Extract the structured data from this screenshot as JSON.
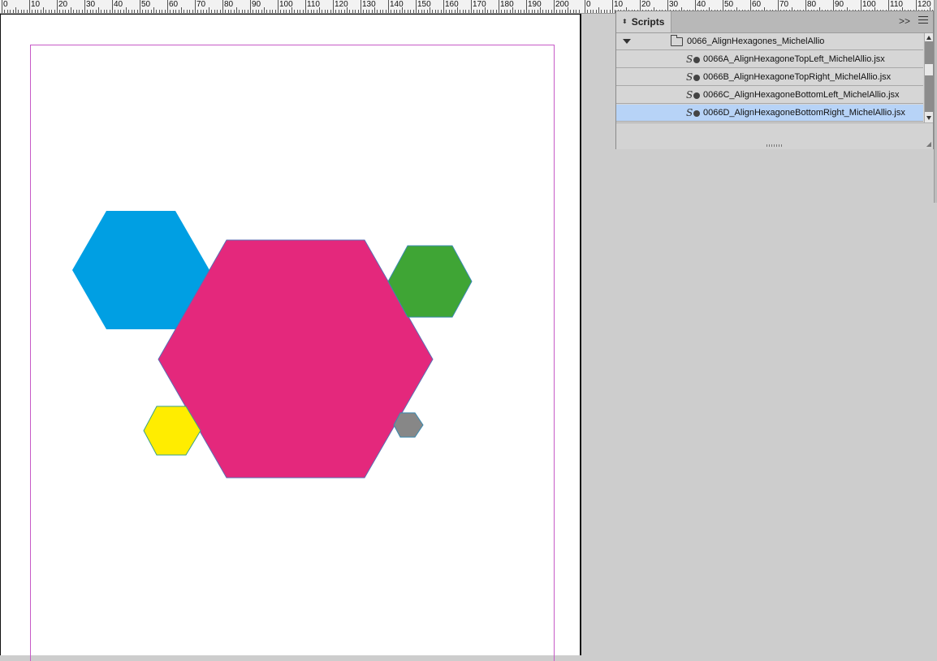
{
  "ruler": {
    "labels_left": [
      "0",
      "10",
      "20",
      "30",
      "40",
      "50",
      "60",
      "70",
      "80",
      "90",
      "100",
      "110",
      "120",
      "130",
      "140",
      "150",
      "160",
      "170",
      "180",
      "190",
      "200"
    ],
    "labels_right": [
      "0",
      "10",
      "20",
      "30",
      "40",
      "50",
      "60",
      "70",
      "80",
      "90",
      "100",
      "110",
      "120"
    ]
  },
  "panel": {
    "title": "Scripts",
    "collapse_glyph": ">>",
    "folder": "0066_AlignHexagones_MichelAllio",
    "scripts": [
      {
        "label": "0066A_AlignHexagoneTopLeft_MichelAllio.jsx",
        "selected": false
      },
      {
        "label": "0066B_AlignHexagoneTopRight_MichelAllio.jsx",
        "selected": false
      },
      {
        "label": "0066C_AlignHexagoneBottomLeft_MichelAllio.jsx",
        "selected": false
      },
      {
        "label": "0066D_AlignHexagoneBottomRight_MichelAllio.jsx",
        "selected": true
      }
    ]
  },
  "artwork": {
    "hexagons": [
      {
        "name": "blue",
        "fill": "#009fe3"
      },
      {
        "name": "magenta",
        "fill": "#e4287c"
      },
      {
        "name": "green",
        "fill": "#3fa535"
      },
      {
        "name": "yellow",
        "fill": "#ffed00"
      },
      {
        "name": "gray",
        "fill": "#878787"
      }
    ]
  },
  "colors": {
    "accent_selection": "#b7d3f7",
    "margin_guide": "#c75ac7"
  }
}
